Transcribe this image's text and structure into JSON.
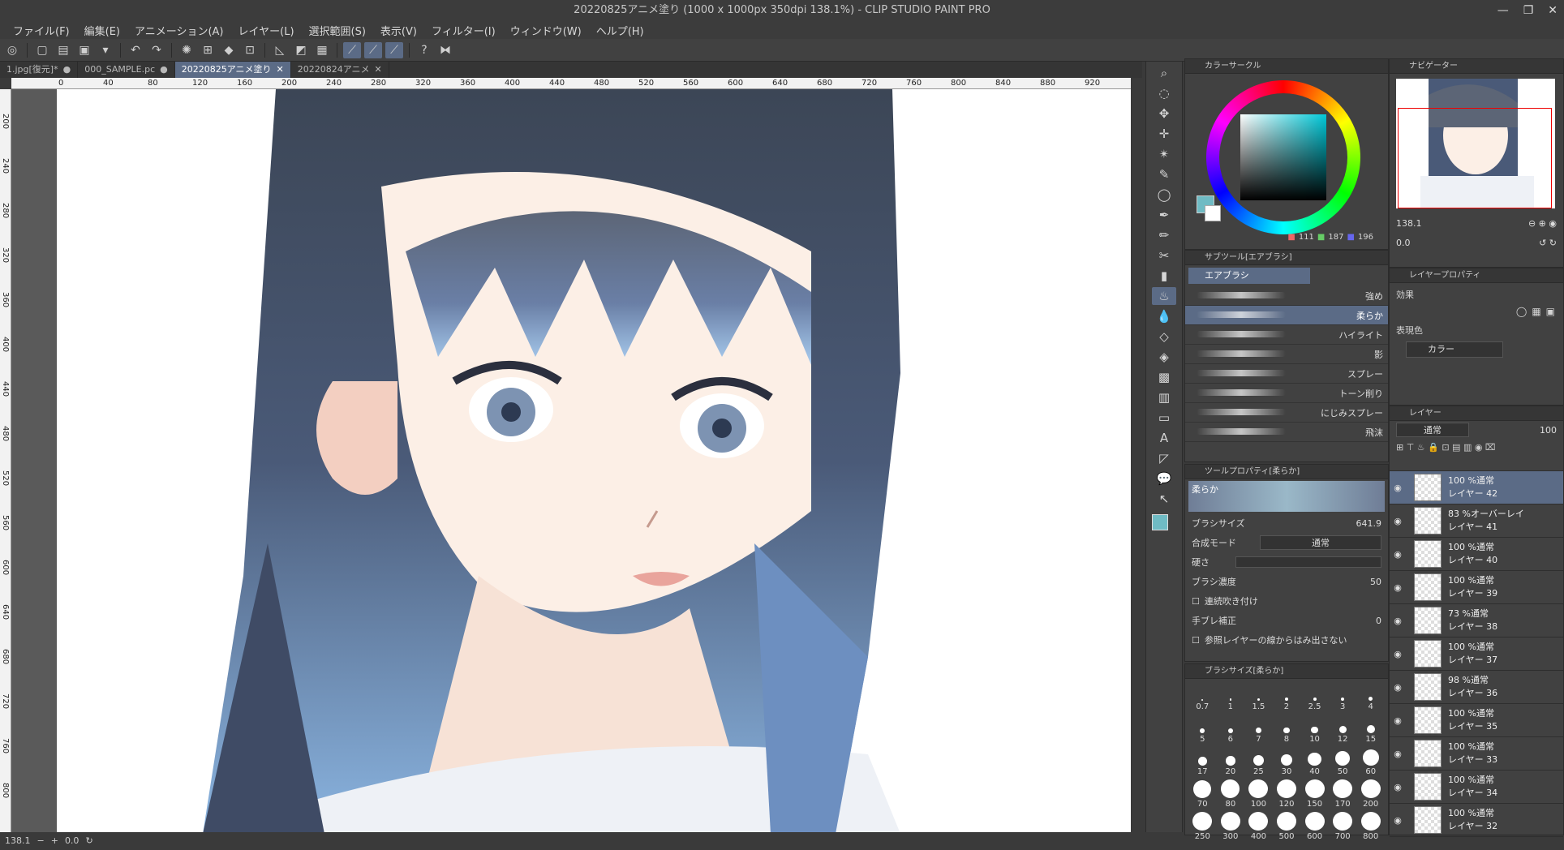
{
  "window": {
    "title": "20220825アニメ塗り (1000 x 1000px 350dpi 138.1%)  - CLIP STUDIO PAINT PRO",
    "controls": [
      "—",
      "❐",
      "✕"
    ]
  },
  "menu": [
    "ファイル(F)",
    "編集(E)",
    "アニメーション(A)",
    "レイヤー(L)",
    "選択範囲(S)",
    "表示(V)",
    "フィルター(I)",
    "ウィンドウ(W)",
    "ヘルプ(H)"
  ],
  "tabs": [
    {
      "label": "1.jpg[復元]*"
    },
    {
      "label": "000_SAMPLE.pc"
    },
    {
      "label": "20220825アニメ塗り"
    },
    {
      "label": "20220824アニメ"
    }
  ],
  "ruler_h": [
    "0",
    "40",
    "80",
    "120",
    "160",
    "200",
    "240",
    "280",
    "320",
    "360",
    "400",
    "440",
    "480",
    "520",
    "560",
    "600",
    "640",
    "680",
    "720",
    "760",
    "800",
    "840",
    "880",
    "920"
  ],
  "ruler_v": [
    "200",
    "240",
    "280",
    "320",
    "360",
    "400",
    "440",
    "480",
    "520",
    "560",
    "600",
    "640",
    "680",
    "720",
    "760",
    "800"
  ],
  "status": {
    "zoom": "138.1",
    "angle": "0.0"
  },
  "color": {
    "title": "カラーサークル",
    "r": "111",
    "g": "187",
    "b": "196",
    "main_hex": "#6fbbc4"
  },
  "subtool": {
    "title": "サブツール[エアブラシ]",
    "group": "エアブラシ",
    "items": [
      "強め",
      "柔らか",
      "ハイライト",
      "影",
      "スプレー",
      "トーン削り",
      "にじみスプレー",
      "飛沫"
    ]
  },
  "toolprop": {
    "title": "ツールプロパティ[柔らか]",
    "preview_label": "柔らか",
    "brush_size_label": "ブラシサイズ",
    "brush_size": "641.9",
    "blend_label": "合成モード",
    "blend": "通常",
    "hardness_label": "硬さ",
    "density_label": "ブラシ濃度",
    "density": "50",
    "continuous_label": "連続吹き付け",
    "stabilize_label": "手ブレ補正",
    "stabilize": "0",
    "ref_label": "参照レイヤーの線からはみ出さない"
  },
  "brushsize": {
    "title": "ブラシサイズ[柔らか]",
    "sizes": [
      "0.7",
      "1",
      "1.5",
      "2",
      "2.5",
      "3",
      "4",
      "5",
      "6",
      "7",
      "8",
      "10",
      "12",
      "15",
      "17",
      "20",
      "25",
      "30",
      "40",
      "50",
      "60",
      "70",
      "80",
      "100",
      "120",
      "150",
      "170",
      "200",
      "250",
      "300",
      "400",
      "500",
      "600",
      "700",
      "800"
    ]
  },
  "navigator": {
    "title": "ナビゲーター",
    "zoom": "138.1",
    "angle": "0.0"
  },
  "layerprop": {
    "title": "レイヤープロパティ",
    "effect_label": "効果",
    "express_label": "表現色",
    "express_value": "カラー"
  },
  "layers": {
    "title": "レイヤー",
    "blend": "通常",
    "opacity": "100",
    "items": [
      {
        "mode": "100 %通常",
        "name": "レイヤー 42"
      },
      {
        "mode": "83 %オーバーレイ",
        "name": "レイヤー 41"
      },
      {
        "mode": "100 %通常",
        "name": "レイヤー 40"
      },
      {
        "mode": "100 %通常",
        "name": "レイヤー 39"
      },
      {
        "mode": "73 %通常",
        "name": "レイヤー 38"
      },
      {
        "mode": "100 %通常",
        "name": "レイヤー 37"
      },
      {
        "mode": "98 %通常",
        "name": "レイヤー 36"
      },
      {
        "mode": "100 %通常",
        "name": "レイヤー 35"
      },
      {
        "mode": "100 %通常",
        "name": "レイヤー 33"
      },
      {
        "mode": "100 %通常",
        "name": "レイヤー 34"
      },
      {
        "mode": "100 %通常",
        "name": "レイヤー 32"
      }
    ]
  }
}
